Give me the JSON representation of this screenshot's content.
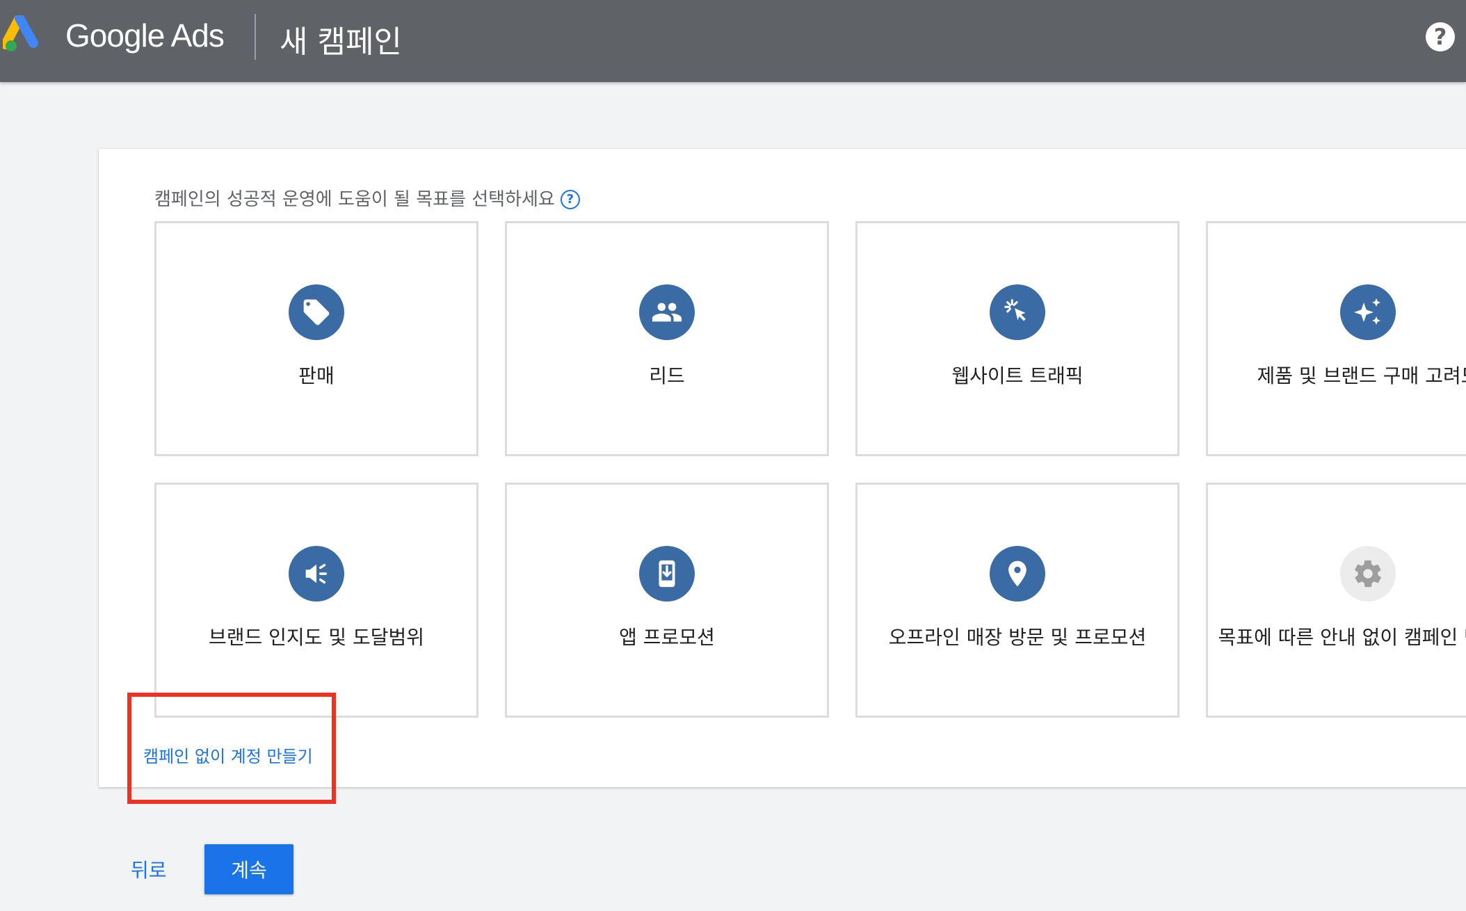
{
  "header": {
    "brand": "Google Ads",
    "page_title": "새 캠페인",
    "help_glyph": "?"
  },
  "panel": {
    "subtitle": "캠페인의 성공적 운영에 도움이 될 목표를 선택하세요",
    "subtitle_help_glyph": "?",
    "goals": [
      {
        "label": "판매",
        "icon": "tag-icon"
      },
      {
        "label": "리드",
        "icon": "people-icon"
      },
      {
        "label": "웹사이트 트래픽",
        "icon": "cursor-click-icon"
      },
      {
        "label": "제품 및 브랜드 구매 고려도",
        "icon": "sparkle-icon"
      },
      {
        "label": "브랜드 인지도 및 도달범위",
        "icon": "megaphone-icon"
      },
      {
        "label": "앱 프로모션",
        "icon": "phone-download-icon"
      },
      {
        "label": "오프라인 매장 방문 및 프로모션",
        "icon": "location-pin-icon"
      },
      {
        "label": "목표에 따른 안내 없이 캠페인 만들기",
        "icon": "gear-icon"
      }
    ],
    "no_campaign_link": "캠페인 없이 계정 만들기"
  },
  "footer": {
    "back_label": "뒤로",
    "continue_label": "계속"
  },
  "colors": {
    "header_bg": "#5f6368",
    "icon_blue": "#3b6ba5",
    "link_blue": "#1a73e8",
    "highlight_red": "#ea3323"
  }
}
